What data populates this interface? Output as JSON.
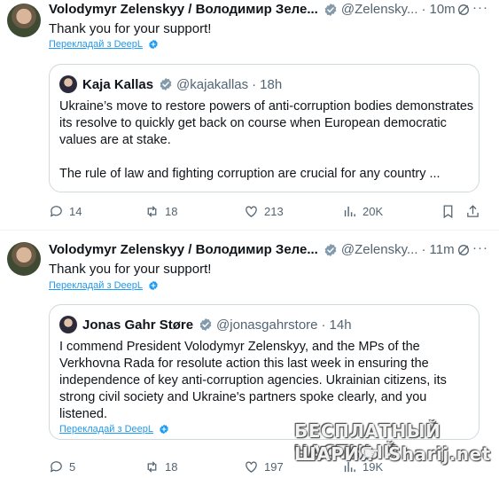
{
  "tweets": [
    {
      "author_name": "Volodymyr Zelenskyy / Володимир Зеле...",
      "handle": "@Zelensky...",
      "time": "10m",
      "text": "Thank you for your support!",
      "translate": "Перекладай з DeepL",
      "quote": {
        "author_name": "Kaja Kallas",
        "handle": "@kajakallas",
        "time": "18h",
        "paragraph1": "Ukraine’s move to restore powers of anti-corruption bodies demonstrates its resolve to quickly get back on course when European democratic values are at stake.",
        "paragraph2": "The rule of law and fighting corruption are crucial for any country ...",
        "translate": ""
      },
      "actions": {
        "replies": "14",
        "reposts": "18",
        "likes": "213",
        "views": "20K"
      }
    },
    {
      "author_name": "Volodymyr Zelenskyy / Володимир Зеле...",
      "handle": "@Zelensky...",
      "time": "11m",
      "text": "Thank you for your support!",
      "translate": "Перекладай з DeepL",
      "quote": {
        "author_name": "Jonas Gahr Støre",
        "handle": "@jonasgahrstore",
        "time": "14h",
        "paragraph1": "I commend President Volodymyr Zelenskyy, and the MPs of the Verkhovna Rada for resolute action this last week in ensuring the independence of key anti-corruption agencies. Ukrainian citizens, its strong civil society and Ukraine's partners spoke clearly, and you listened.",
        "paragraph2": "",
        "translate": "Перекладай з DeepL"
      },
      "actions": {
        "replies": "5",
        "reposts": "18",
        "likes": "197",
        "views": "19K"
      }
    }
  ],
  "watermark": {
    "line1": "БЕСПЛАТНЫЙ ЧАСТНЫЙ",
    "line2_left": "ШАРИЯ",
    "line2_right": "Sharij.net"
  },
  "colors": {
    "accent": "#1d9bf0",
    "muted": "#536471",
    "verified": "#829aab",
    "border": "#cfd9de"
  },
  "icons": [
    "verified-badge-icon",
    "grok-icon",
    "more-icon",
    "reply-icon",
    "repost-icon",
    "like-icon",
    "views-icon",
    "bookmark-icon",
    "share-icon",
    "deepl-badge-icon"
  ]
}
